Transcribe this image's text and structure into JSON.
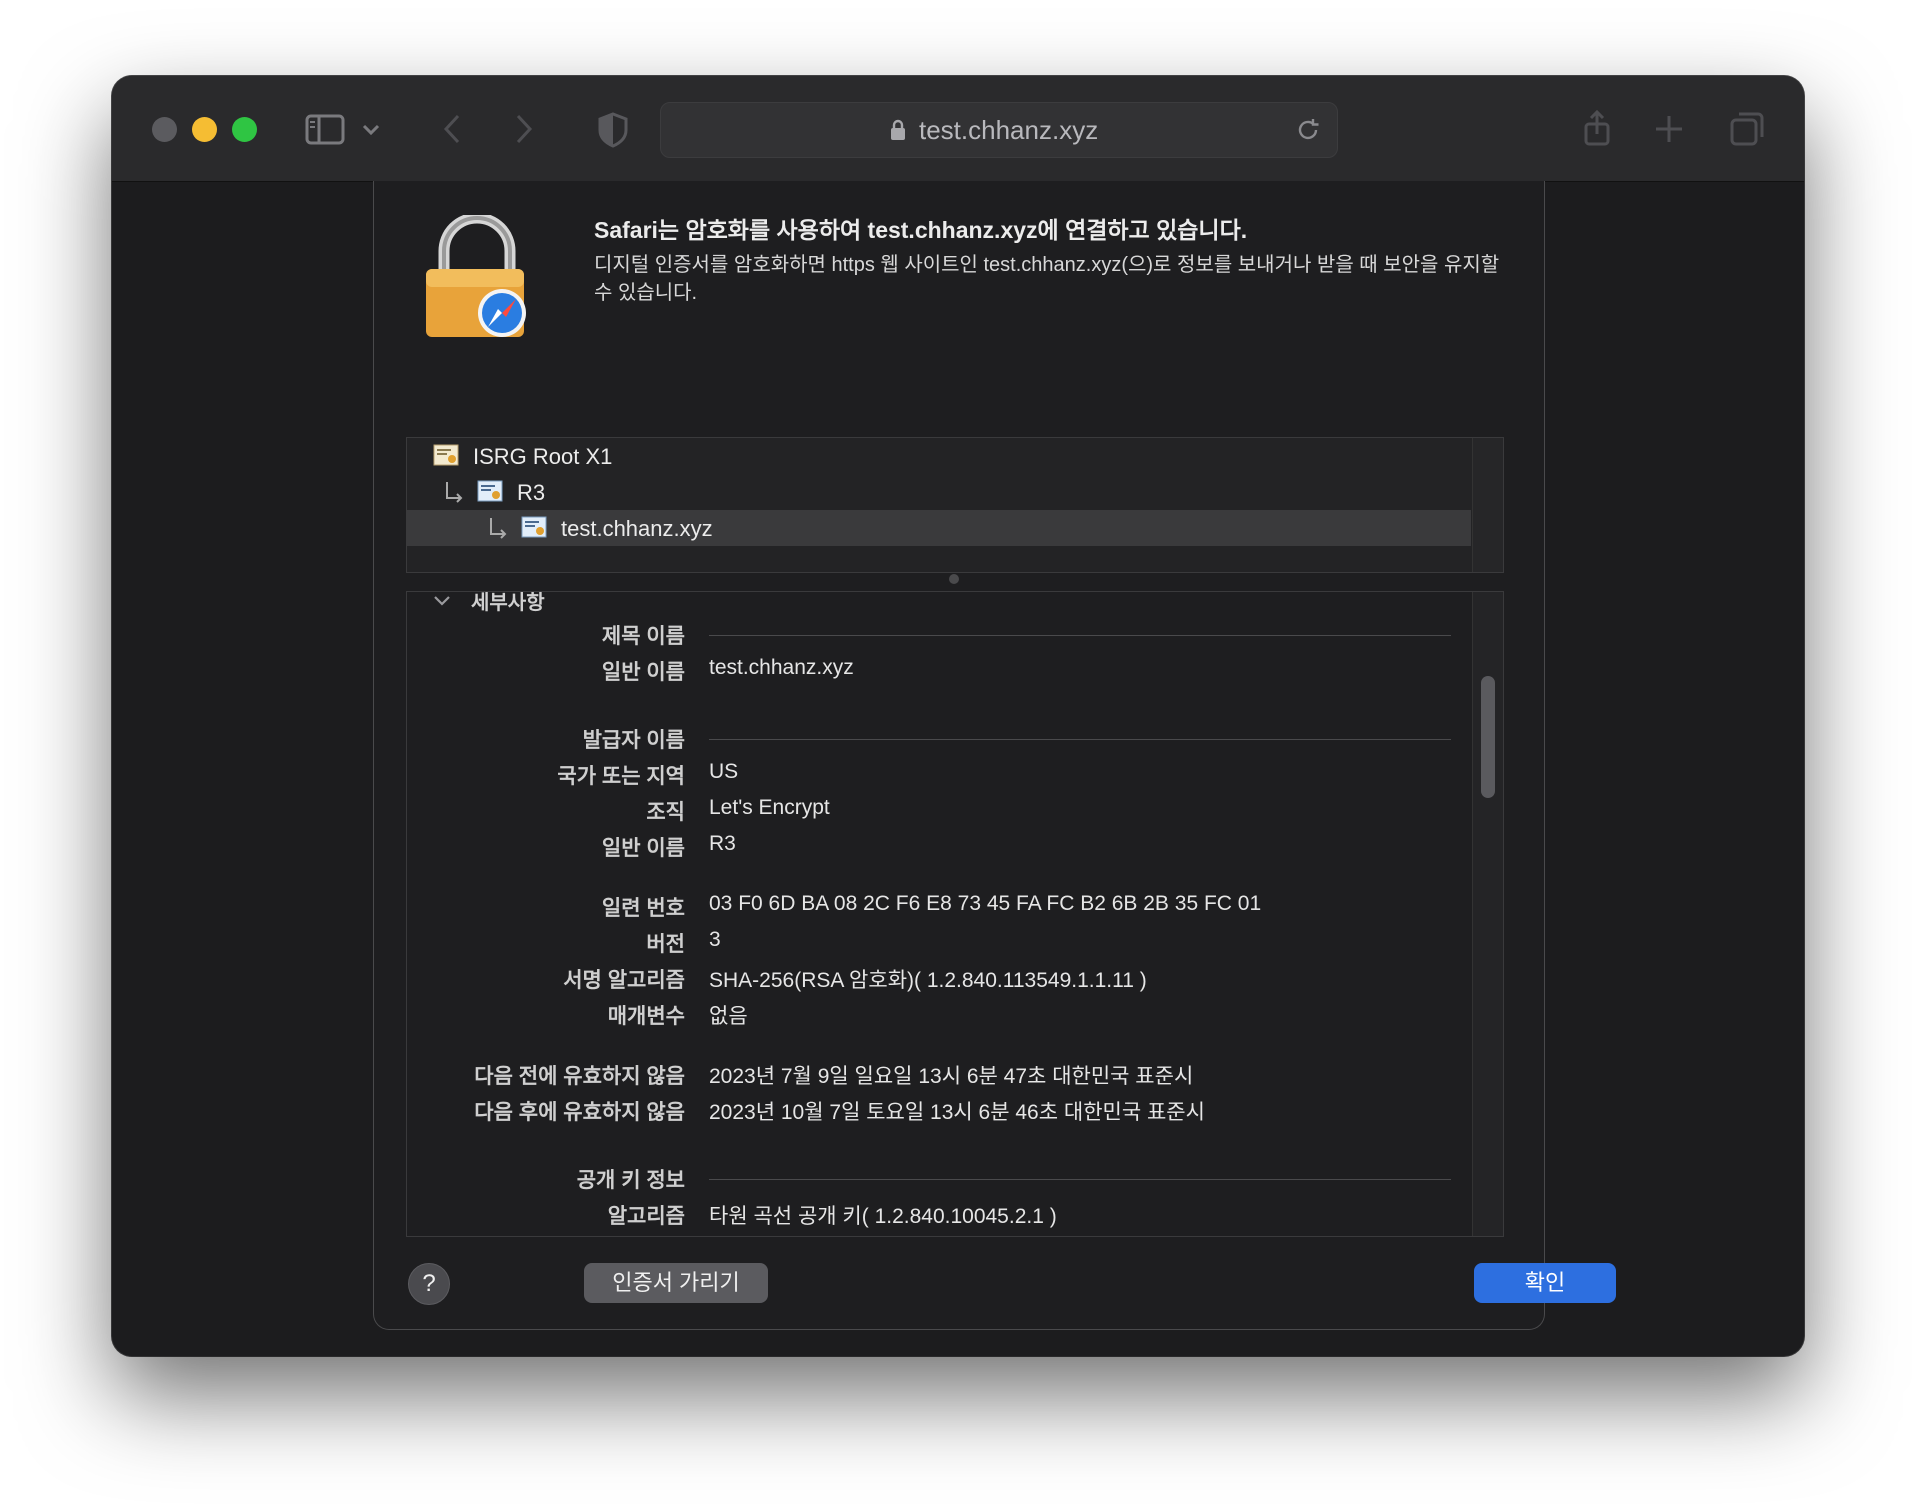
{
  "browser": {
    "url": "test.chhanz.xyz"
  },
  "dialog": {
    "title": "Safari는 암호화를 사용하여 test.chhanz.xyz에 연결하고 있습니다.",
    "description": "디지털 인증서를 암호화하면 https 웹 사이트인 test.chhanz.xyz(으)로 정보를 보내거나 받을 때 보안을 유지할 수 있습니다."
  },
  "cert_chain": [
    {
      "label": "ISRG Root X1"
    },
    {
      "label": "R3"
    },
    {
      "label": "test.chhanz.xyz",
      "selected": true
    }
  ],
  "details": {
    "section_title": "세부사항",
    "subject_header": "제목 이름",
    "subject_cn_label": "일반 이름",
    "subject_cn": "test.chhanz.xyz",
    "issuer_header": "발급자 이름",
    "issuer_country_label": "국가 또는 지역",
    "issuer_country": "US",
    "issuer_org_label": "조직",
    "issuer_org": "Let's Encrypt",
    "issuer_cn_label": "일반 이름",
    "issuer_cn": "R3",
    "serial_label": "일련 번호",
    "serial": "03 F0 6D BA 08 2C F6 E8 73 45 FA FC B2 6B 2B 35 FC 01",
    "version_label": "버전",
    "version": "3",
    "sig_alg_label": "서명 알고리즘",
    "sig_alg": "SHA-256(RSA 암호화)( 1.2.840.113549.1.1.11 )",
    "params_label": "매개변수",
    "params": "없음",
    "not_before_label": "다음 전에 유효하지 않음",
    "not_before": "2023년 7월 9일 일요일 13시 6분 47초 대한민국 표준시",
    "not_after_label": "다음 후에 유효하지 않음",
    "not_after": "2023년 10월 7일 토요일 13시 6분 46초 대한민국 표준시",
    "pubkey_header": "공개 키 정보",
    "pubkey_alg_label": "알고리즘",
    "pubkey_alg": "타원 곡선 공개 키( 1.2.840.10045.2.1 )"
  },
  "buttons": {
    "help": "?",
    "hide_cert": "인증서 가리기",
    "ok": "확인"
  },
  "colors": {
    "accent": "#2d6fe0",
    "window_bg": "#1c1c1e",
    "traffic_yellow": "#f5bd33",
    "traffic_green": "#2fc543"
  }
}
